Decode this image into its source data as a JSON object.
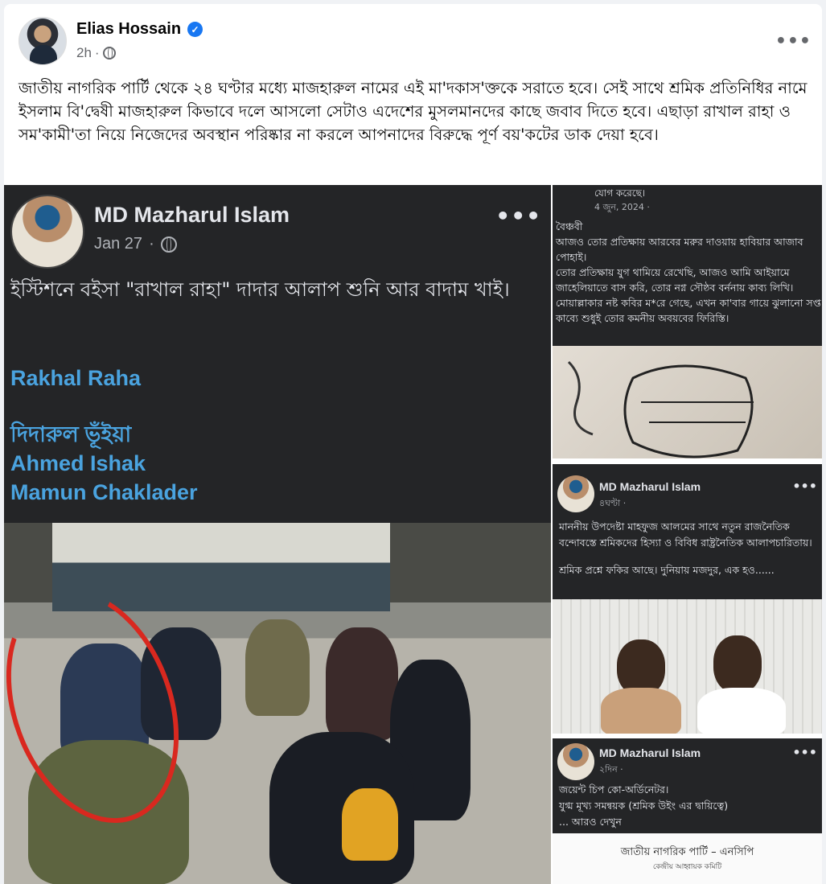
{
  "post": {
    "author": "Elias Hossain",
    "time": "2h",
    "separator": "·",
    "text": "জাতীয় নাগরিক পার্টি থেকে ২৪ ঘণ্টার মধ্যে মাজহারুল নামের এই মা'দকাস'ক্তকে সরাতে হবে। সেই সাথে শ্রমিক প্রতিনিধির নামে ইসলাম বি'দ্বেষী মাজহারুল কিভাবে দলে আসলো সেটাও এদেশের মুসলমানদের কাছে জবাব দিতে হবে। এছাড়া রাখাল রাহা ও সম'কামী'তা নিয়ে নিজেদের অবস্থান পরিষ্কার না করলে আপনাদের বিরুদ্ধে পূর্ণ বয়'কটের ডাক দেয়া হবে।",
    "more": "•••"
  },
  "screenshot_left": {
    "author": "MD Mazharul Islam",
    "date": "Jan 27",
    "separator": "·",
    "more": "•••",
    "text": "ইস্টিশনে বইসা \"রাখাল রাহা\" দাদার আলাপ শুনি আর বাদাম খাই।",
    "tag1": "Rakhal Raha",
    "tag2": "দিদারুল ভূঁইয়া",
    "tag3": "Ahmed Ishak",
    "tag4": "Mamun Chaklader"
  },
  "screenshot_r1": {
    "top": "যোগ করেছে।",
    "date": "4 জুন, 2024 · ",
    "text": "বৈঞ্চবী\nআজও তোর প্রতিক্ষায় আরবের মরুর দাওয়ায় হাবিয়ার আজাব পোহাই।\nতোর প্রতিক্ষায় যুগ থামিয়ে রেখেছি, আজও আমি আইয়ামে জাহেলিয়াতে বাস করি, তোর নগ্ন সৌষ্ঠব বর্ননায় কাব্য লিখি।\nমোয়াল্লাকার নষ্ট কবির ম*রে গেছে, এখন কা'বার গায়ে ঝুলানো সপ্ত কাব্যে শুধুই তোর কমনীয় অবয়বের ফিরিস্তি।"
  },
  "screenshot_r2": {
    "author": "MD Mazharul Islam",
    "date": "৪ঘণ্টা · ",
    "more": "•••",
    "text1": "মাননীয় উপদেষ্টা মাহফুজ আলমের সাথে নতুন রাজনৈতিক বন্দোবস্তে শ্রমিকদের হিস্যা ও বিবিধ রাষ্ট্রনৈতিক আলাপচারিতায়।",
    "text2": "শ্রমিক প্রশ্নে ফকির আছে। দুনিয়ায় মজদুর, এক হও......"
  },
  "screenshot_r3": {
    "author": "MD Mazharul Islam",
    "date": "২দিন · ",
    "more": "•••",
    "line1": "জয়েন্ট চিপ কো-অর্ডিনেটর।",
    "line2": "যুগ্ম মূখ্য সমন্বয়ক (শ্রমিক উইং এর দ্বায়িত্বে)",
    "see_more": "... আরও দেখুন",
    "doc_title": "জাতীয় নাগরিক পার্টি – এনসিপি",
    "doc_sub": "কেন্দ্রীয় আহ্বায়ক কমিটি"
  },
  "colors": {
    "link_blue": "#4aa3df",
    "verified": "#1877f2",
    "dark_bg": "#242527",
    "red_circle": "#d9281f"
  }
}
